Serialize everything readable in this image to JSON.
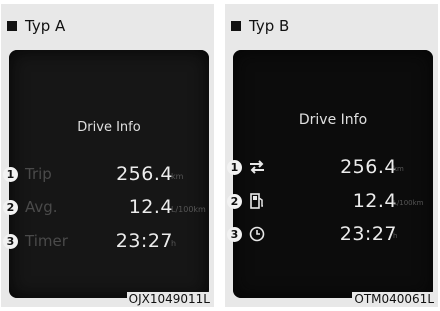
{
  "panels": [
    {
      "title": "Typ A",
      "screen_title": "Drive Info",
      "rows": [
        {
          "num": "1",
          "label": "Trip",
          "value": "256.4",
          "unit": "km"
        },
        {
          "num": "2",
          "label": "Avg.",
          "value": "12.4",
          "unit": "L/100km"
        },
        {
          "num": "3",
          "label": "Timer",
          "value": "23:27",
          "unit": "h"
        }
      ],
      "caption": "OJX1049011L"
    },
    {
      "title": "Typ B",
      "screen_title": "Drive Info",
      "rows": [
        {
          "num": "1",
          "icon": "trip-arrows-icon",
          "value": "256.4",
          "unit": "km"
        },
        {
          "num": "2",
          "icon": "fuel-pump-icon",
          "value": "12.4",
          "unit": "L/100km"
        },
        {
          "num": "3",
          "icon": "clock-icon",
          "value": "23:27",
          "unit": "h"
        }
      ],
      "caption": "OTM040061L"
    }
  ]
}
